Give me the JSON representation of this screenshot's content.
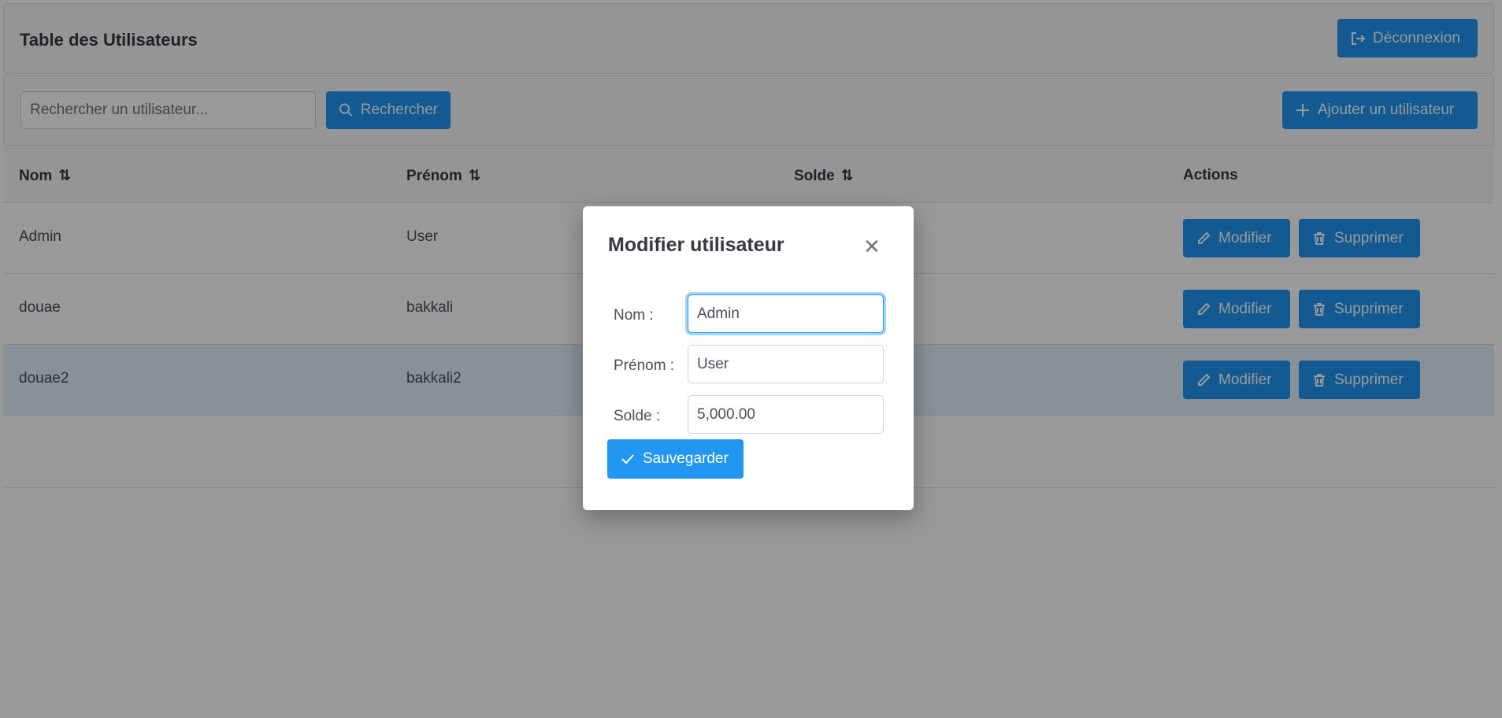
{
  "header": {
    "title": "Table des Utilisateurs",
    "logout_label": "Déconnexion"
  },
  "toolbar": {
    "search_placeholder": "Rechercher un utilisateur...",
    "search_label": "Rechercher",
    "add_label": "Ajouter un utilisateur"
  },
  "table": {
    "columns": [
      "Nom",
      "Prénom",
      "Solde",
      "Actions"
    ],
    "rows": [
      {
        "nom": "Admin",
        "prenom": "User"
      },
      {
        "nom": "douae",
        "prenom": "bakkali"
      },
      {
        "nom": "douae2",
        "prenom": "bakkali2"
      }
    ],
    "edit_label": "Modifier",
    "delete_label": "Supprimer"
  },
  "modal": {
    "title": "Modifier utilisateur",
    "nom_label": "Nom :",
    "prenom_label": "Prénom :",
    "solde_label": "Solde :",
    "nom_value": "Admin",
    "prenom_value": "User",
    "solde_value": "5,000.00",
    "save_label": "Sauvegarder"
  },
  "colors": {
    "primary": "#2196F3",
    "row_highlight": "#e3f2fd"
  }
}
